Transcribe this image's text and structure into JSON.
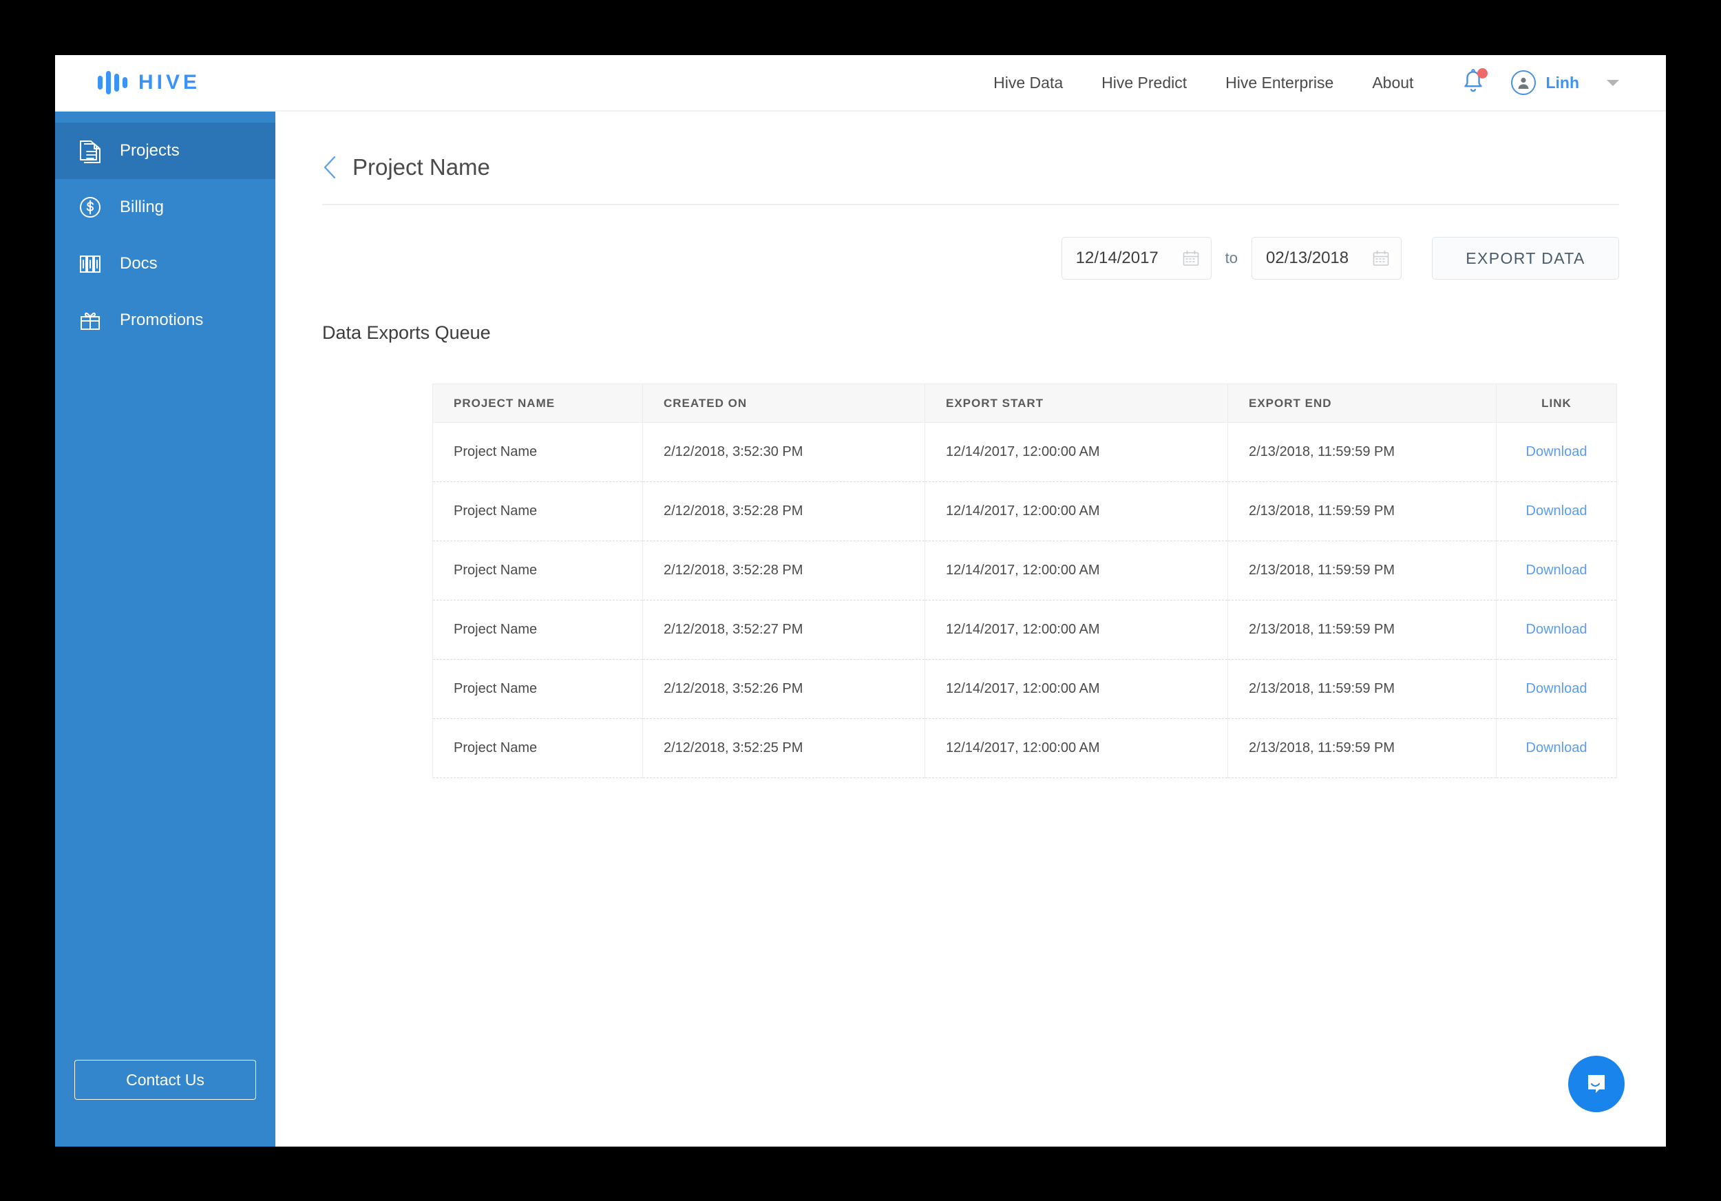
{
  "brand": {
    "name": "HIVE",
    "logo_icon": "hive-bars-logo"
  },
  "top_nav": {
    "links": [
      {
        "label": "Hive Data"
      },
      {
        "label": "Hive Predict"
      },
      {
        "label": "Hive Enterprise"
      },
      {
        "label": "About"
      }
    ],
    "notifications_icon": "bell-icon",
    "has_notification_badge": true,
    "user": {
      "name": "Linh",
      "avatar_icon": "user-avatar-icon",
      "caret_icon": "chevron-down-icon"
    }
  },
  "sidebar": {
    "items": [
      {
        "label": "Projects",
        "icon": "documents-icon",
        "active": true
      },
      {
        "label": "Billing",
        "icon": "dollar-circle-icon",
        "active": false
      },
      {
        "label": "Docs",
        "icon": "books-icon",
        "active": false
      },
      {
        "label": "Promotions",
        "icon": "gift-icon",
        "active": false
      }
    ],
    "contact_label": "Contact Us"
  },
  "page": {
    "back_icon": "back-chevron-icon",
    "title": "Project Name",
    "section_title": "Data Exports Queue"
  },
  "toolbar": {
    "date_from": "12/14/2017",
    "date_from_placeholder": "MM/DD/YYYY",
    "date_to": "02/13/2018",
    "date_to_placeholder": "MM/DD/YYYY",
    "separator": "to",
    "calendar_icon": "calendar-icon",
    "export_label": "EXPORT DATA"
  },
  "table": {
    "columns": [
      "PROJECT NAME",
      "CREATED ON",
      "EXPORT START",
      "EXPORT END",
      "LINK"
    ],
    "rows": [
      {
        "project_name": "Project Name",
        "created_on": "2/12/2018, 3:52:30 PM",
        "export_start": "12/14/2017, 12:00:00 AM",
        "export_end": "2/13/2018, 11:59:59 PM",
        "link": "Download"
      },
      {
        "project_name": "Project Name",
        "created_on": "2/12/2018, 3:52:28 PM",
        "export_start": "12/14/2017, 12:00:00 AM",
        "export_end": "2/13/2018, 11:59:59 PM",
        "link": "Download"
      },
      {
        "project_name": "Project Name",
        "created_on": "2/12/2018, 3:52:28 PM",
        "export_start": "12/14/2017, 12:00:00 AM",
        "export_end": "2/13/2018, 11:59:59 PM",
        "link": "Download"
      },
      {
        "project_name": "Project Name",
        "created_on": "2/12/2018, 3:52:27 PM",
        "export_start": "12/14/2017, 12:00:00 AM",
        "export_end": "2/13/2018, 11:59:59 PM",
        "link": "Download"
      },
      {
        "project_name": "Project Name",
        "created_on": "2/12/2018, 3:52:26 PM",
        "export_start": "12/14/2017, 12:00:00 AM",
        "export_end": "2/13/2018, 11:59:59 PM",
        "link": "Download"
      },
      {
        "project_name": "Project Name",
        "created_on": "2/12/2018, 3:52:25 PM",
        "export_start": "12/14/2017, 12:00:00 AM",
        "export_end": "2/13/2018, 11:59:59 PM",
        "link": "Download"
      }
    ]
  },
  "chat_widget": {
    "icon": "chat-bubble-icon"
  },
  "colors": {
    "brand_blue": "#3b93f7",
    "sidebar_blue": "#3385cc",
    "sidebar_active_blue": "#2b74b5",
    "link_blue": "#5a9cf0",
    "badge_red": "#ef6b6b",
    "chat_blue": "#1a84ed"
  }
}
